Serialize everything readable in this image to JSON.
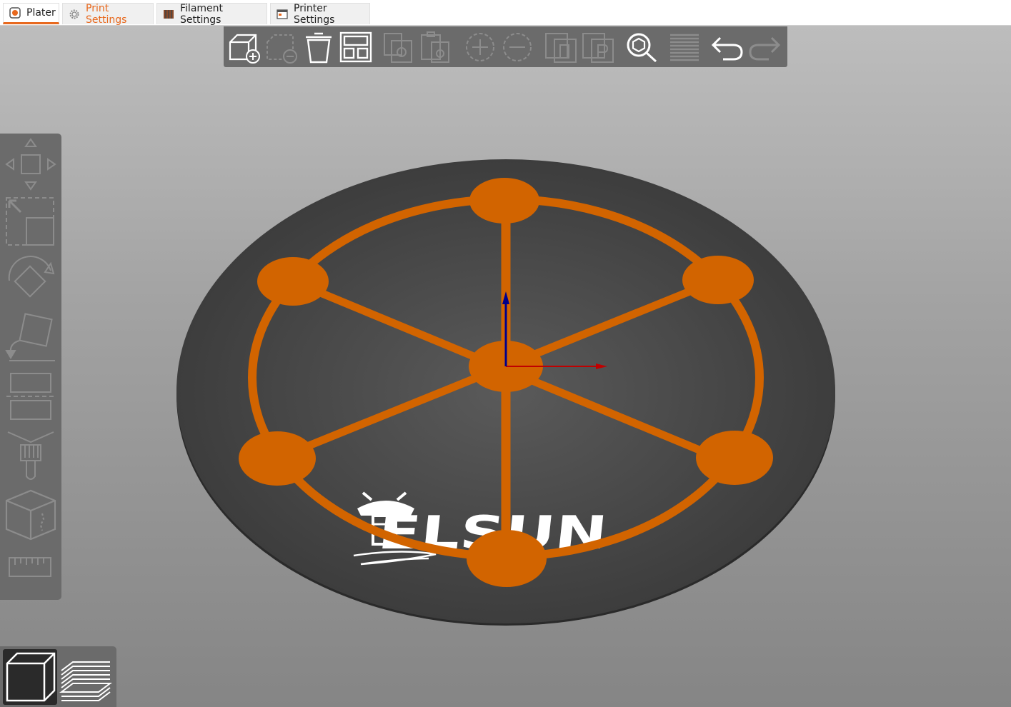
{
  "tabs": [
    {
      "label": "Plater",
      "icon": "plater-icon",
      "active": true
    },
    {
      "label": "Print Settings",
      "icon": "print-settings-gear-icon"
    },
    {
      "label": "Filament Settings",
      "icon": "filament-spool-icon"
    },
    {
      "label": "Printer Settings",
      "icon": "printer-window-icon"
    }
  ],
  "toolbar": [
    {
      "name": "add",
      "icon": "add-object-icon",
      "enabled": true
    },
    {
      "name": "delete",
      "icon": "delete-object-icon",
      "enabled": false
    },
    {
      "name": "delete-all",
      "icon": "trash-icon",
      "enabled": true
    },
    {
      "name": "arrange",
      "icon": "arrange-icon",
      "enabled": true
    },
    {
      "name": "copy",
      "icon": "copy-icon",
      "enabled": false
    },
    {
      "name": "paste",
      "icon": "paste-icon",
      "enabled": false
    },
    {
      "name": "add-instance",
      "icon": "plus-circle-icon",
      "enabled": false
    },
    {
      "name": "remove-instance",
      "icon": "minus-circle-icon",
      "enabled": false
    },
    {
      "name": "split-objects",
      "icon": "split-objects-icon",
      "enabled": false
    },
    {
      "name": "split-parts",
      "icon": "split-parts-icon",
      "enabled": false
    },
    {
      "name": "search",
      "icon": "search-icon",
      "enabled": true
    },
    {
      "name": "layers-editing",
      "icon": "layers-icon",
      "enabled": false
    },
    {
      "name": "undo",
      "icon": "undo-icon",
      "enabled": true
    },
    {
      "name": "redo",
      "icon": "redo-icon",
      "enabled": false
    }
  ],
  "gizmos": [
    {
      "name": "move",
      "icon": "move-icon"
    },
    {
      "name": "scale",
      "icon": "scale-icon"
    },
    {
      "name": "rotate",
      "icon": "rotate-icon"
    },
    {
      "name": "place-on-face",
      "icon": "place-on-face-icon"
    },
    {
      "name": "cut",
      "icon": "cut-icon"
    },
    {
      "name": "paint-supports",
      "icon": "paint-brush-icon"
    },
    {
      "name": "seam",
      "icon": "seam-cube-icon"
    },
    {
      "name": "measure",
      "icon": "ruler-icon"
    }
  ],
  "views": [
    {
      "name": "3d-view",
      "icon": "cube-view-icon",
      "active": true
    },
    {
      "name": "preview",
      "icon": "layers-preview-icon",
      "active": false
    }
  ],
  "bed_logo_text": "ELSUN",
  "colors": {
    "accent": "#e8691e",
    "model": "#d26400",
    "bed": "#3f3f3f",
    "toolbar_bg": "#6b6b6b",
    "axis_x": "#c00000",
    "axis_z": "#00008b"
  }
}
